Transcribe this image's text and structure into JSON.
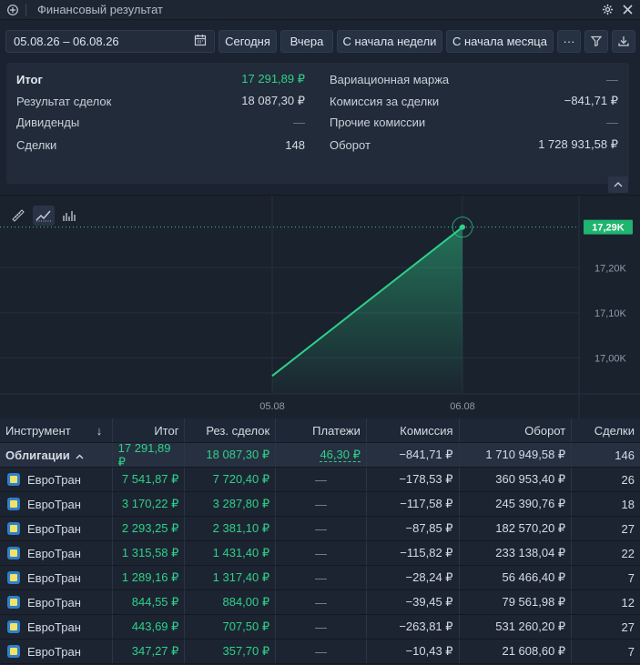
{
  "window": {
    "title": "Финансовый результат"
  },
  "toolbar": {
    "date_range": "05.08.26 – 06.08.26",
    "today": "Сегодня",
    "yesterday": "Вчера",
    "week": "С начала недели",
    "month": "С начала месяца",
    "more": "···"
  },
  "summary": {
    "left": [
      {
        "label": "Итог",
        "value": "17 291,89 ₽"
      },
      {
        "label": "Результат сделок",
        "value": "18 087,30 ₽"
      },
      {
        "label": "Дивиденды",
        "value": "—"
      },
      {
        "label": "Сделки",
        "value": "148"
      }
    ],
    "right": [
      {
        "label": "Вариационная маржа",
        "value": "—"
      },
      {
        "label": "Комиссия за сделки",
        "value": "−841,71 ₽"
      },
      {
        "label": "Прочие комиссии",
        "value": "—"
      },
      {
        "label": "Оборот",
        "value": "1 728 931,58 ₽"
      }
    ]
  },
  "chart_data": {
    "type": "area",
    "x": [
      "05.08",
      "06.08"
    ],
    "values": [
      16.96,
      17.29
    ],
    "yticks": [
      "17,00K",
      "17,10K",
      "17,20K"
    ],
    "ytick_values": [
      17.0,
      17.1,
      17.2
    ],
    "current_label": "17,29K",
    "ylim": [
      16.92,
      17.36
    ],
    "color": "#2fd18a"
  },
  "table": {
    "headers": {
      "instrument": "Инструмент",
      "sort": "↓",
      "total": "Итог",
      "deals_result": "Рез. сделок",
      "payments": "Платежи",
      "commission": "Комиссия",
      "turnover": "Оборот",
      "deals": "Сделки"
    },
    "group": {
      "name": "Облигации",
      "chevron": "^",
      "total": "17 291,89 ₽",
      "deals_result": "18 087,30 ₽",
      "payments": "46,30 ₽",
      "commission": "−841,71 ₽",
      "turnover": "1 710 949,58 ₽",
      "deals": "146"
    },
    "rows": [
      {
        "name": "ЕвроТран",
        "total": "7 541,87 ₽",
        "deals_result": "7 720,40 ₽",
        "payments": "—",
        "commission": "−178,53 ₽",
        "turnover": "360 953,40 ₽",
        "deals": "26"
      },
      {
        "name": "ЕвроТран",
        "total": "3 170,22 ₽",
        "deals_result": "3 287,80 ₽",
        "payments": "—",
        "commission": "−117,58 ₽",
        "turnover": "245 390,76 ₽",
        "deals": "18"
      },
      {
        "name": "ЕвроТран",
        "total": "2 293,25 ₽",
        "deals_result": "2 381,10 ₽",
        "payments": "—",
        "commission": "−87,85 ₽",
        "turnover": "182 570,20 ₽",
        "deals": "27"
      },
      {
        "name": "ЕвроТран",
        "total": "1 315,58 ₽",
        "deals_result": "1 431,40 ₽",
        "payments": "—",
        "commission": "−115,82 ₽",
        "turnover": "233 138,04 ₽",
        "deals": "22"
      },
      {
        "name": "ЕвроТран",
        "total": "1 289,16 ₽",
        "deals_result": "1 317,40 ₽",
        "payments": "—",
        "commission": "−28,24 ₽",
        "turnover": "56 466,40 ₽",
        "deals": "7"
      },
      {
        "name": "ЕвроТран",
        "total": "844,55 ₽",
        "deals_result": "884,00 ₽",
        "payments": "—",
        "commission": "−39,45 ₽",
        "turnover": "79 561,98 ₽",
        "deals": "12"
      },
      {
        "name": "ЕвроТран",
        "total": "443,69 ₽",
        "deals_result": "707,50 ₽",
        "payments": "—",
        "commission": "−263,81 ₽",
        "turnover": "531 260,20 ₽",
        "deals": "27"
      },
      {
        "name": "ЕвроТран",
        "total": "347,27 ₽",
        "deals_result": "357,70 ₽",
        "payments": "—",
        "commission": "−10,43 ₽",
        "turnover": "21 608,60 ₽",
        "deals": "7"
      }
    ]
  }
}
